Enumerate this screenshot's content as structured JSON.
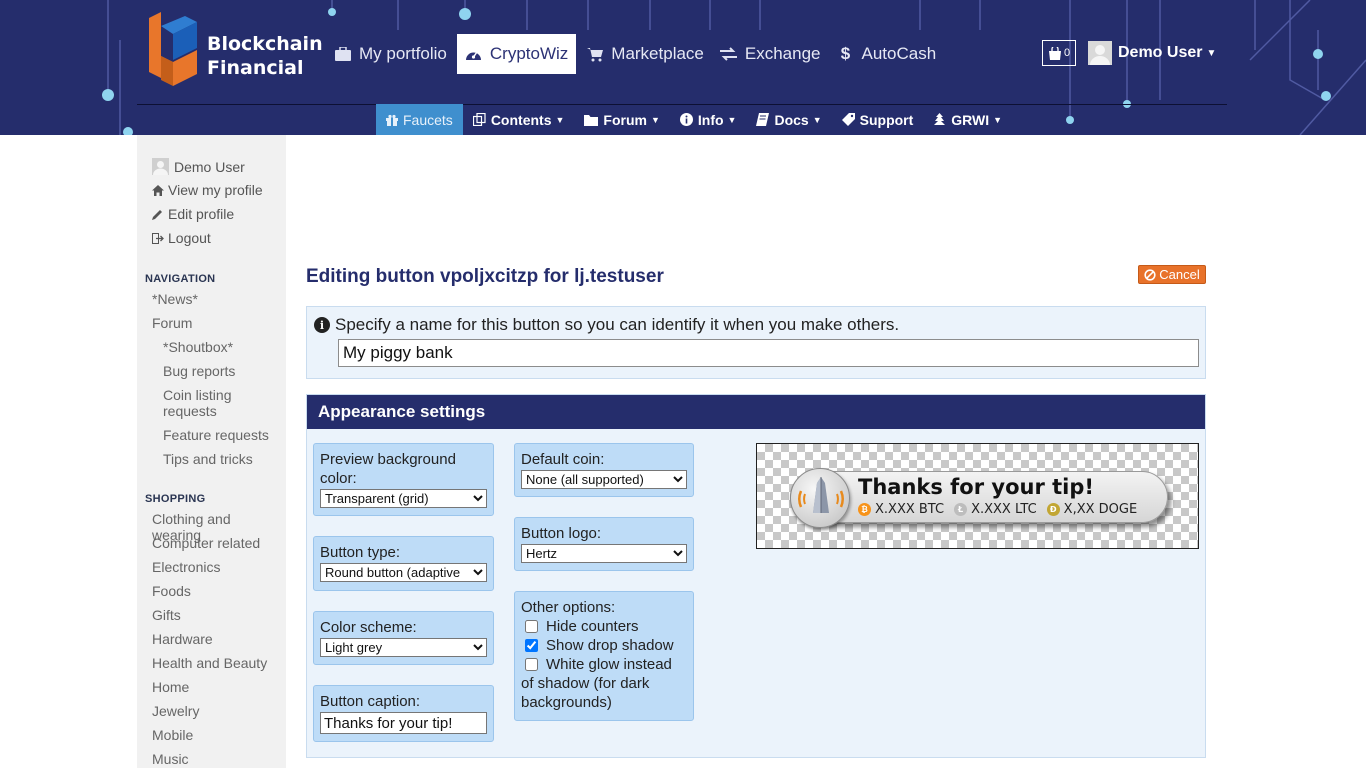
{
  "brand": {
    "line1": "Blockchain",
    "line2": "Financial"
  },
  "topnav": [
    {
      "label": "My portfolio",
      "icon": "briefcase-icon"
    },
    {
      "label": "CryptoWiz",
      "icon": "dashboard-icon",
      "active": true
    },
    {
      "label": "Marketplace",
      "icon": "cart-icon"
    },
    {
      "label": "Exchange",
      "icon": "exchange-icon"
    },
    {
      "label": "AutoCash",
      "icon": "dollar-icon"
    }
  ],
  "cart": {
    "count": "0"
  },
  "user": {
    "name": "Demo User"
  },
  "subnav": [
    {
      "label": "Faucets",
      "icon": "gift-icon",
      "active": true
    },
    {
      "label": "Contents",
      "icon": "copy-icon",
      "dropdown": true
    },
    {
      "label": "Forum",
      "icon": "folder-icon",
      "dropdown": true
    },
    {
      "label": "Info",
      "icon": "info-icon",
      "dropdown": true
    },
    {
      "label": "Docs",
      "icon": "book-icon",
      "dropdown": true
    },
    {
      "label": "Support",
      "icon": "tag-icon"
    },
    {
      "label": "GRWI",
      "icon": "tree-icon",
      "dropdown": true
    }
  ],
  "sidebar": {
    "user": "Demo User",
    "links": [
      "View my profile",
      "Edit profile",
      "Logout"
    ],
    "navigation_title": "NAVIGATION",
    "navigation": [
      "*News*",
      "Forum"
    ],
    "forum_sub": [
      "*Shoutbox*",
      "Bug reports",
      "Coin listing requests",
      "Feature requests",
      "Tips and tricks"
    ],
    "shopping_title": "SHOPPING",
    "shopping": [
      "Clothing and wearing",
      "Computer related",
      "Electronics",
      "Foods",
      "Gifts",
      "Hardware",
      "Health and Beauty",
      "Home",
      "Jewelry",
      "Mobile",
      "Music"
    ]
  },
  "main": {
    "title": "Editing button vpoljxcitzp for lj.testuser",
    "cancel_label": "Cancel",
    "name_hint": "Specify a name for this button so you can identify it when you make others.",
    "name_value": "My piggy bank",
    "appearance_title": "Appearance settings",
    "fields": {
      "preview_bg_label": "Preview background color:",
      "preview_bg_value": "Transparent (grid)",
      "button_type_label": "Button type:",
      "button_type_value": "Round button (adaptive",
      "color_scheme_label": "Color scheme:",
      "color_scheme_value": "Light grey",
      "caption_label": "Button caption:",
      "caption_value": "Thanks for your tip!",
      "default_coin_label": "Default coin:",
      "default_coin_value": "None (all supported)",
      "button_logo_label": "Button logo:",
      "button_logo_value": "Hertz",
      "other_label": "Other options:",
      "opt_hide_counters": "Hide counters",
      "opt_shadow": "Show drop shadow",
      "opt_glow": "White glow instead of shadow (for dark backgrounds)"
    },
    "options_state": {
      "hide_counters": false,
      "show_shadow": true,
      "white_glow": false
    },
    "preview": {
      "caption": "Thanks for your tip!",
      "coins": [
        {
          "label": "X.XXX BTC",
          "color": "#f7931a"
        },
        {
          "label": "X.XXX LTC",
          "color": "#bdbdbd"
        },
        {
          "label": "X,XX DOGE",
          "color": "#c2a633"
        }
      ]
    }
  },
  "colors": {
    "header_bg": "#252d6c",
    "accent_blue": "#3f8fce",
    "cancel_orange": "#e8722a",
    "field_bg": "#bedcf7"
  }
}
